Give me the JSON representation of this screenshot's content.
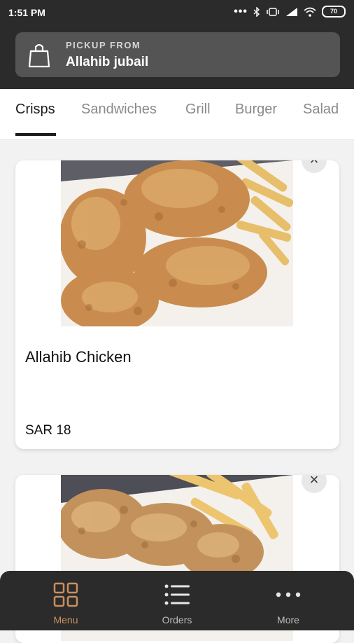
{
  "status_bar": {
    "time": "1:51 PM",
    "icons": [
      "more-dots-icon",
      "bluetooth-icon",
      "vibrate-icon",
      "signal-icon",
      "wifi-icon",
      "battery-icon"
    ],
    "battery": "70"
  },
  "pickup": {
    "label": "PICKUP FROM",
    "location": "Allahib jubail",
    "icon": "shopping-bag-icon"
  },
  "tabs": [
    {
      "label": "Crisps",
      "active": true
    },
    {
      "label": "Sandwiches",
      "active": false
    },
    {
      "label": "Grill",
      "active": false
    },
    {
      "label": "Burger",
      "active": false
    },
    {
      "label": "Salad",
      "active": false
    }
  ],
  "items": [
    {
      "name": "Allahib Chicken",
      "price": "SAR 18",
      "image": "fried-chicken-with-fries"
    },
    {
      "name": "",
      "price": "",
      "image": "crispy-chicken-strips-with-fries"
    }
  ],
  "bottom_nav": [
    {
      "label": "Menu",
      "icon": "grid-icon",
      "active": true
    },
    {
      "label": "Orders",
      "icon": "list-icon",
      "active": false
    },
    {
      "label": "More",
      "icon": "more-dots-icon",
      "active": false
    }
  ],
  "colors": {
    "header_bg": "#2b2b2b",
    "pickup_bg": "#545454",
    "accent": "#c89060",
    "nav_bg": "#2b2b2b"
  }
}
